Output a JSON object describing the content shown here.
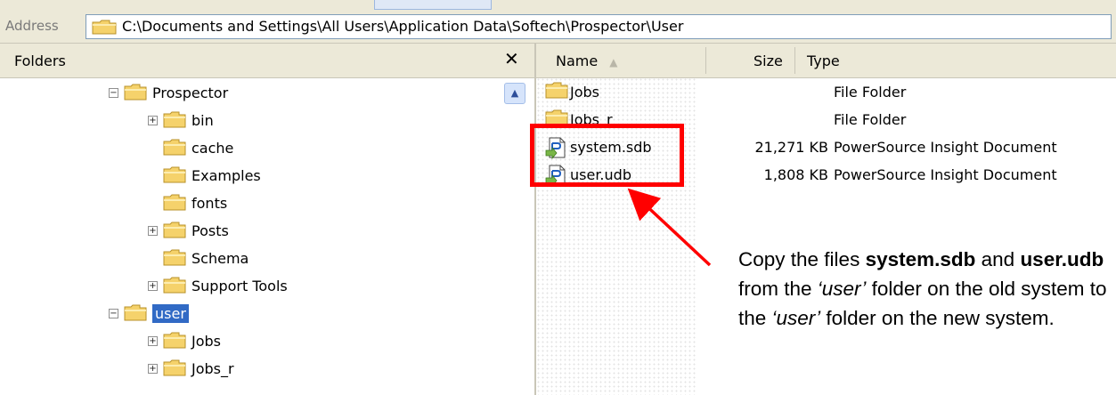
{
  "address": {
    "label": "Address",
    "path": "C:\\Documents and Settings\\All Users\\Application Data\\Softech\\Prospector\\User"
  },
  "folders_pane": {
    "title": "Folders",
    "close": "✕",
    "tree": [
      {
        "label": "Prospector",
        "expander": "−"
      },
      {
        "label": "bin",
        "expander": "+"
      },
      {
        "label": "cache",
        "expander": ""
      },
      {
        "label": "Examples",
        "expander": ""
      },
      {
        "label": "fonts",
        "expander": ""
      },
      {
        "label": "Posts",
        "expander": "+"
      },
      {
        "label": "Schema",
        "expander": ""
      },
      {
        "label": "Support Tools",
        "expander": "+"
      },
      {
        "label": "user",
        "expander": "−",
        "selected": true
      },
      {
        "label": "Jobs",
        "expander": "+"
      },
      {
        "label": "Jobs_r",
        "expander": "+"
      }
    ]
  },
  "file_list": {
    "columns": {
      "name": "Name",
      "size": "Size",
      "type": "Type"
    },
    "sort_indicator": "▲",
    "rows": [
      {
        "name": "Jobs",
        "size": "",
        "type": "File Folder",
        "icon": "folder-icon"
      },
      {
        "name": "Jobs_r",
        "size": "",
        "type": "File Folder",
        "icon": "folder-icon"
      },
      {
        "name": "system.sdb",
        "size": "21,271 KB",
        "type": "PowerSource Insight Document",
        "icon": "document-icon"
      },
      {
        "name": "user.udb",
        "size": "1,808 KB",
        "type": "PowerSource Insight Document",
        "icon": "document-icon"
      }
    ]
  },
  "callout": {
    "t1": "Copy the files ",
    "b1": "system.sdb",
    "t2": " and ",
    "b2": "user.udb",
    "t3": " from the ",
    "i1": "‘user’",
    "t4": " folder on the old system to the ",
    "i2": "‘user’",
    "t5": " folder on the new system."
  },
  "colors": {
    "highlight": "#ff0000",
    "selection": "#316ac5",
    "folder": "#f5d26b"
  }
}
